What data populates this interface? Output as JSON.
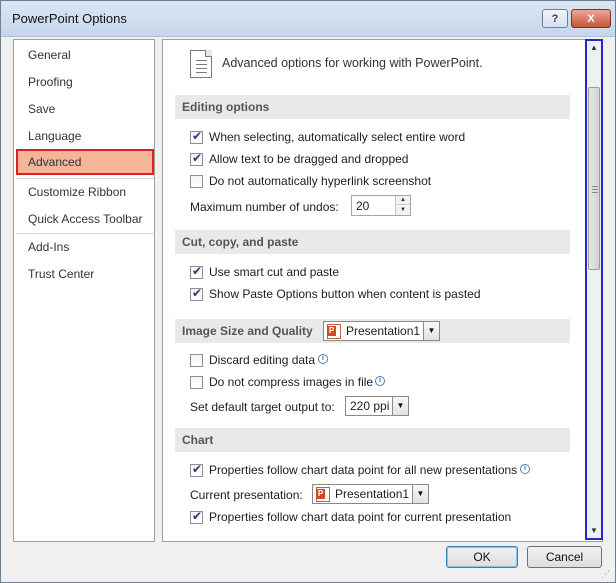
{
  "window": {
    "title": "PowerPoint Options",
    "help_label": "?",
    "close_label": "X"
  },
  "sidebar": {
    "items": [
      {
        "label": "General"
      },
      {
        "label": "Proofing"
      },
      {
        "label": "Save"
      },
      {
        "label": "Language"
      },
      {
        "label": "Advanced",
        "selected": true
      },
      {
        "label": "Customize Ribbon"
      },
      {
        "label": "Quick Access Toolbar"
      },
      {
        "label": "Add-Ins"
      },
      {
        "label": "Trust Center"
      }
    ]
  },
  "content": {
    "header": "Advanced options for working with PowerPoint.",
    "editing": {
      "title": "Editing options",
      "select_word": {
        "label": "When selecting, automatically select entire word",
        "checked": true
      },
      "drag_drop": {
        "label": "Allow text to be dragged and dropped",
        "checked": true
      },
      "no_hyperlink": {
        "label": "Do not automatically hyperlink screenshot",
        "checked": false
      },
      "undos_label": "Maximum number of undos:",
      "undos_value": "20"
    },
    "cut_copy": {
      "title": "Cut, copy, and paste",
      "smart_cut": {
        "label": "Use smart cut and paste",
        "checked": true
      },
      "paste_options": {
        "label": "Show Paste Options button when content is pasted",
        "checked": true
      }
    },
    "image": {
      "title": "Image Size and Quality",
      "presentation": "Presentation1",
      "discard": {
        "label": "Discard editing data",
        "checked": false
      },
      "no_compress": {
        "label": "Do not compress images in file",
        "checked": false
      },
      "target_label": "Set default target output to:",
      "target_value": "220 ppi"
    },
    "chart": {
      "title": "Chart",
      "all_new": {
        "label": "Properties follow chart data point for all new presentations",
        "checked": true
      },
      "current_label": "Current presentation:",
      "current_value": "Presentation1",
      "current": {
        "label": "Properties follow chart data point for current presentation",
        "checked": true
      }
    }
  },
  "buttons": {
    "ok": "OK",
    "cancel": "Cancel"
  },
  "colors": {
    "selected_nav_bg": "#f6b598",
    "selected_nav_border": "#e0201f",
    "scrollbar_highlight": "#1d2bd1"
  }
}
